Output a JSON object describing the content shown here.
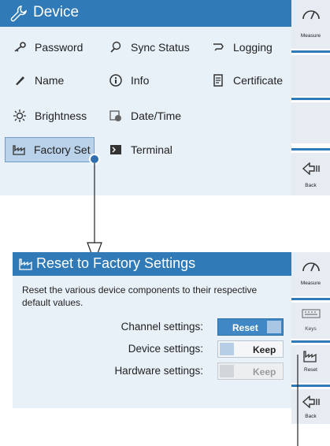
{
  "screen1": {
    "title": "Device",
    "menu": {
      "password": "Password",
      "sync_status": "Sync Status",
      "logging": "Logging",
      "name": "Name",
      "info": "Info",
      "certificate": "Certificate",
      "brightness": "Brightness",
      "date_time": "Date/Time",
      "factory_set": "Factory Set",
      "terminal": "Terminal"
    },
    "sidebar": {
      "measure": "Measure",
      "back": "Back"
    }
  },
  "screen2": {
    "title": "Reset to Factory Settings",
    "description": "Reset the various device components to their respective default values.",
    "settings": [
      {
        "label": "Channel settings:",
        "value": "Reset",
        "state": "reset"
      },
      {
        "label": "Device settings:",
        "value": "Keep",
        "state": "keep"
      },
      {
        "label": "Hardware settings:",
        "value": "Keep",
        "state": "keep-disabled"
      }
    ],
    "sidebar": {
      "measure": "Measure",
      "keys": "Keys",
      "reset": "Reset",
      "back": "Back"
    }
  },
  "colors": {
    "accent": "#2f7ab7",
    "panel": "#e8f0f8",
    "selected": "#b9d2ea"
  }
}
